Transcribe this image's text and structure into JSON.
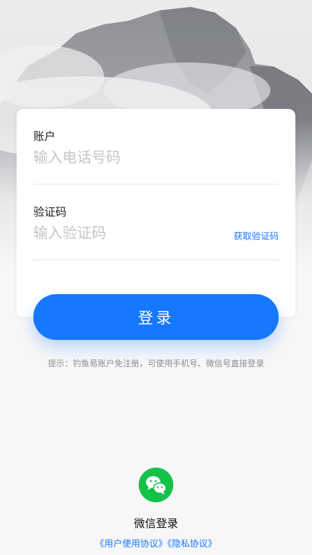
{
  "form": {
    "account_label": "账户",
    "account_placeholder": "输入电话号码",
    "code_label": "验证码",
    "code_placeholder": "输入验证码",
    "get_code_link": "获取验证码",
    "login_button": "登录"
  },
  "hint": "提示：钓鱼易账户免注册，可使用手机号、微信号直接登录",
  "wechat": {
    "icon": "wechat-icon",
    "label": "微信登录"
  },
  "agreements": {
    "user_agreement": "《用户使用协议》",
    "privacy_policy": "《隐私协议》"
  },
  "colors": {
    "accent": "#1677ff",
    "wechat_green": "#14c24a",
    "background": "#f7f7f8"
  }
}
